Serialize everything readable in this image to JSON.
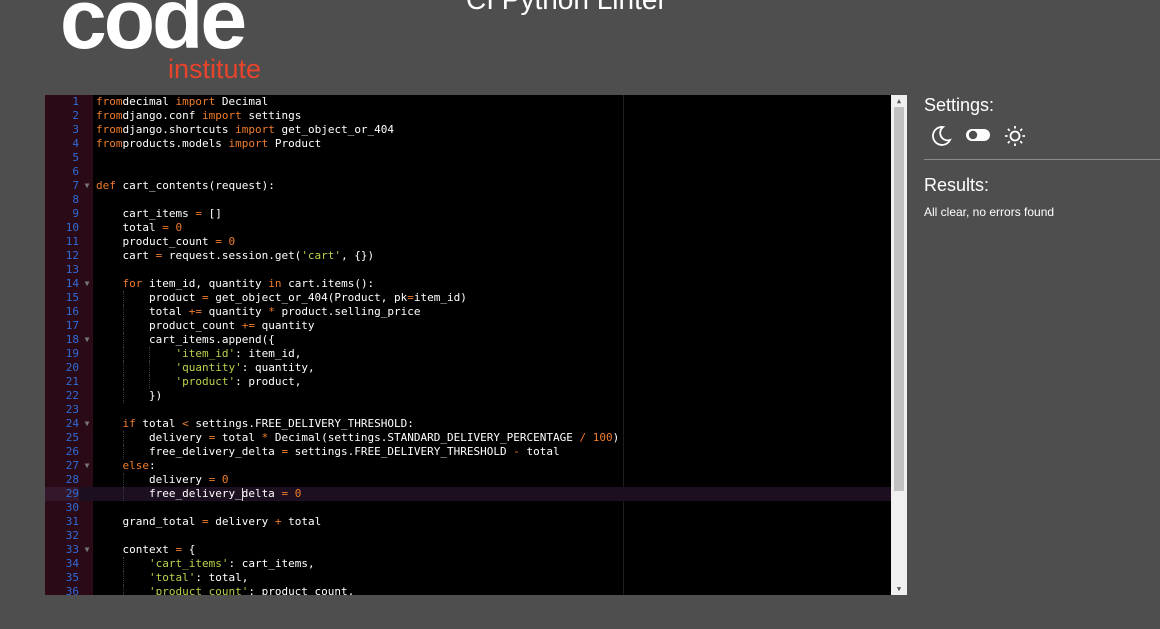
{
  "header": {
    "logo_primary": "code",
    "logo_secondary": "institute",
    "app_title": "CI Python Linter"
  },
  "editor": {
    "lines": [
      {
        "n": "1",
        "fold": false,
        "tokens": [
          [
            "kw",
            "from"
          ],
          [
            "",
            "decimal "
          ],
          [
            "kw",
            "import"
          ],
          [
            "",
            " Decimal"
          ]
        ]
      },
      {
        "n": "2",
        "fold": false,
        "tokens": [
          [
            "kw",
            "from"
          ],
          [
            "",
            "django.conf "
          ],
          [
            "kw",
            "import"
          ],
          [
            "",
            " settings"
          ]
        ]
      },
      {
        "n": "3",
        "fold": false,
        "tokens": [
          [
            "kw",
            "from"
          ],
          [
            "",
            "django.shortcuts "
          ],
          [
            "kw",
            "import"
          ],
          [
            "",
            " get_object_or_404"
          ]
        ]
      },
      {
        "n": "4",
        "fold": false,
        "tokens": [
          [
            "kw",
            "from"
          ],
          [
            "",
            "products.models "
          ],
          [
            "kw",
            "import"
          ],
          [
            "",
            " Product"
          ]
        ]
      },
      {
        "n": "5",
        "fold": false,
        "tokens": []
      },
      {
        "n": "6",
        "fold": false,
        "tokens": []
      },
      {
        "n": "7",
        "fold": true,
        "tokens": [
          [
            "kw",
            "def"
          ],
          [
            "",
            " cart_contents(request):"
          ]
        ]
      },
      {
        "n": "8",
        "fold": false,
        "tokens": []
      },
      {
        "n": "9",
        "fold": false,
        "tokens": [
          [
            "",
            "    cart_items "
          ],
          [
            "op",
            "="
          ],
          [
            "",
            " []"
          ]
        ]
      },
      {
        "n": "10",
        "fold": false,
        "tokens": [
          [
            "",
            "    total "
          ],
          [
            "op",
            "="
          ],
          [
            "",
            " "
          ],
          [
            "num",
            "0"
          ]
        ]
      },
      {
        "n": "11",
        "fold": false,
        "tokens": [
          [
            "",
            "    product_count "
          ],
          [
            "op",
            "="
          ],
          [
            "",
            " "
          ],
          [
            "num",
            "0"
          ]
        ]
      },
      {
        "n": "12",
        "fold": false,
        "tokens": [
          [
            "",
            "    cart "
          ],
          [
            "op",
            "="
          ],
          [
            "",
            " request.session.get("
          ],
          [
            "str",
            "'cart'"
          ],
          [
            "",
            ", {})"
          ]
        ]
      },
      {
        "n": "13",
        "fold": false,
        "tokens": []
      },
      {
        "n": "14",
        "fold": true,
        "tokens": [
          [
            "",
            "    "
          ],
          [
            "kw",
            "for"
          ],
          [
            "",
            " item_id, quantity "
          ],
          [
            "kw",
            "in"
          ],
          [
            "",
            " cart.items():"
          ]
        ]
      },
      {
        "n": "15",
        "fold": false,
        "tokens": [
          [
            "",
            "        product "
          ],
          [
            "op",
            "="
          ],
          [
            "",
            " get_object_or_404(Product, pk"
          ],
          [
            "op",
            "="
          ],
          [
            "",
            "item_id)"
          ]
        ]
      },
      {
        "n": "16",
        "fold": false,
        "tokens": [
          [
            "",
            "        total "
          ],
          [
            "op",
            "+="
          ],
          [
            "",
            " quantity "
          ],
          [
            "op",
            "*"
          ],
          [
            "",
            " product.selling_price"
          ]
        ]
      },
      {
        "n": "17",
        "fold": false,
        "tokens": [
          [
            "",
            "        product_count "
          ],
          [
            "op",
            "+="
          ],
          [
            "",
            " quantity"
          ]
        ]
      },
      {
        "n": "18",
        "fold": true,
        "tokens": [
          [
            "",
            "        cart_items.append({"
          ]
        ]
      },
      {
        "n": "19",
        "fold": false,
        "tokens": [
          [
            "",
            "            "
          ],
          [
            "str",
            "'item_id'"
          ],
          [
            "",
            ": item_id,"
          ]
        ]
      },
      {
        "n": "20",
        "fold": false,
        "tokens": [
          [
            "",
            "            "
          ],
          [
            "str",
            "'quantity'"
          ],
          [
            "",
            ": quantity,"
          ]
        ]
      },
      {
        "n": "21",
        "fold": false,
        "tokens": [
          [
            "",
            "            "
          ],
          [
            "str",
            "'product'"
          ],
          [
            "",
            ": product,"
          ]
        ]
      },
      {
        "n": "22",
        "fold": false,
        "tokens": [
          [
            "",
            "        })"
          ]
        ]
      },
      {
        "n": "23",
        "fold": false,
        "tokens": []
      },
      {
        "n": "24",
        "fold": true,
        "tokens": [
          [
            "",
            "    "
          ],
          [
            "kw",
            "if"
          ],
          [
            "",
            " total "
          ],
          [
            "op",
            "<"
          ],
          [
            "",
            " settings.FREE_DELIVERY_THRESHOLD:"
          ]
        ]
      },
      {
        "n": "25",
        "fold": false,
        "tokens": [
          [
            "",
            "        delivery "
          ],
          [
            "op",
            "="
          ],
          [
            "",
            " total "
          ],
          [
            "op",
            "*"
          ],
          [
            "",
            " Decimal(settings.STANDARD_DELIVERY_PERCENTAGE "
          ],
          [
            "op",
            "/"
          ],
          [
            "",
            " "
          ],
          [
            "num",
            "100"
          ],
          [
            "",
            ")"
          ]
        ]
      },
      {
        "n": "26",
        "fold": false,
        "tokens": [
          [
            "",
            "        free_delivery_delta "
          ],
          [
            "op",
            "="
          ],
          [
            "",
            " settings.FREE_DELIVERY_THRESHOLD "
          ],
          [
            "op",
            "-"
          ],
          [
            "",
            " total"
          ]
        ]
      },
      {
        "n": "27",
        "fold": true,
        "tokens": [
          [
            "",
            "    "
          ],
          [
            "kw",
            "else"
          ],
          [
            "",
            ":"
          ]
        ]
      },
      {
        "n": "28",
        "fold": false,
        "tokens": [
          [
            "",
            "        delivery "
          ],
          [
            "op",
            "="
          ],
          [
            "",
            " "
          ],
          [
            "num",
            "0"
          ]
        ]
      },
      {
        "n": "29",
        "fold": false,
        "tokens": [
          [
            "",
            "        free_delivery_delta "
          ],
          [
            "op",
            "="
          ],
          [
            "",
            " "
          ],
          [
            "num",
            "0"
          ]
        ]
      },
      {
        "n": "30",
        "fold": false,
        "tokens": []
      },
      {
        "n": "31",
        "fold": false,
        "tokens": [
          [
            "",
            "    grand_total "
          ],
          [
            "op",
            "="
          ],
          [
            "",
            " delivery "
          ],
          [
            "op",
            "+"
          ],
          [
            "",
            " total"
          ]
        ]
      },
      {
        "n": "32",
        "fold": false,
        "tokens": []
      },
      {
        "n": "33",
        "fold": true,
        "tokens": [
          [
            "",
            "    context "
          ],
          [
            "op",
            "="
          ],
          [
            "",
            " {"
          ]
        ]
      },
      {
        "n": "34",
        "fold": false,
        "tokens": [
          [
            "",
            "        "
          ],
          [
            "str",
            "'cart_items'"
          ],
          [
            "",
            ": cart_items,"
          ]
        ]
      },
      {
        "n": "35",
        "fold": false,
        "tokens": [
          [
            "",
            "        "
          ],
          [
            "str",
            "'total'"
          ],
          [
            "",
            ": total,"
          ]
        ]
      },
      {
        "n": "36",
        "fold": false,
        "tokens": [
          [
            "",
            "        "
          ],
          [
            "str",
            "'product_count'"
          ],
          [
            "",
            ": product_count,"
          ]
        ]
      }
    ],
    "active_line": "29"
  },
  "settings": {
    "title": "Settings:",
    "dark_icon": "moon-icon",
    "toggle_icon": "toggle-icon",
    "light_icon": "sun-icon"
  },
  "results": {
    "title": "Results:",
    "message": "All clear, no errors found"
  },
  "colors": {
    "background": "#4e4e4e",
    "brand_orange": "#e6452c",
    "keyword": "#f07c2c",
    "string": "#b8d34a",
    "line_number": "#2f6bd6"
  }
}
